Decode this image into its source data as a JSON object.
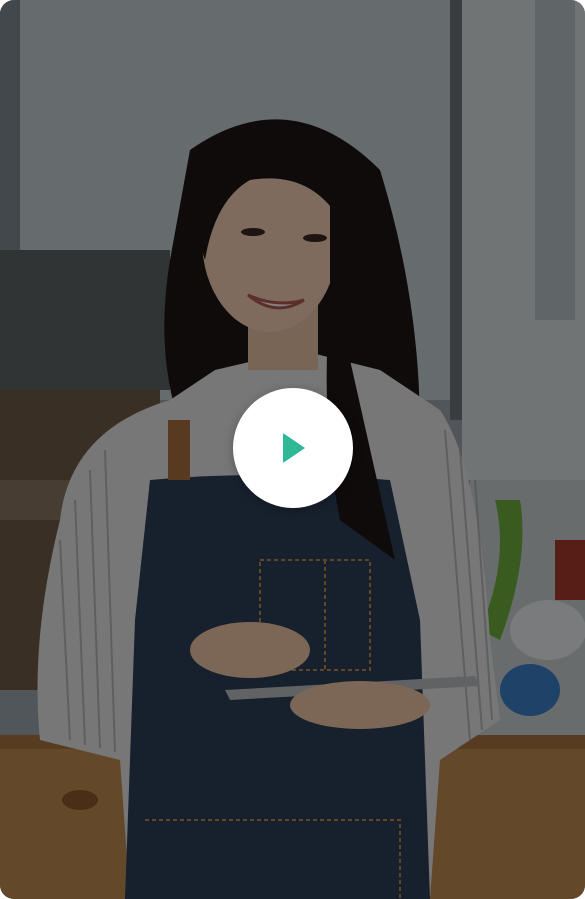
{
  "video": {
    "play_icon": "play-icon",
    "accent_color": "#2fb796",
    "overlay_color": "rgba(0,0,0,0.48)"
  }
}
